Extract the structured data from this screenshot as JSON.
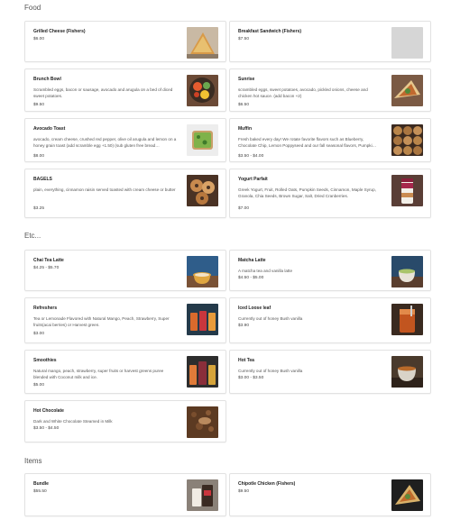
{
  "sections": {
    "food": {
      "title": "Food",
      "items": [
        {
          "name": "Grilled Cheese (Fishers)",
          "desc": "",
          "price": "$6.00",
          "image": "grilled-cheese-photo"
        },
        {
          "name": "Breakfast Sandwich (Fishers)",
          "desc": "",
          "price": "$7.50",
          "image": "placeholder-image"
        },
        {
          "name": "Brunch Bowl",
          "desc": "Scrambled eggs, bacon or sausage, avocado and arugula on a bed of diced sweet potatoes.",
          "price": "$9.50",
          "image": "brunch-bowl-photo"
        },
        {
          "name": "Sunrise",
          "desc": "scrambled eggs, sweet potatoes, avocado, pickled onions, cheese and chicken hot sauce. (add bacon +2)",
          "price": "$6.50",
          "image": "sunrise-photo"
        },
        {
          "name": "Avocado Toast",
          "desc": "avocado, cream cheese, crushed red pepper, olive oil arugula and lemon on a honey grain toast (add scramble egg +1.50) (sub gluten free bread…",
          "price": "$8.00",
          "image": "avocado-toast-photo"
        },
        {
          "name": "Muffin",
          "desc": "Fresh baked every day! We rotate favorite flavors such as Blueberry, Chocolate Chip, Lemon Poppyseed and our fall seasonal flavors, Pumpki…",
          "price": "$3.50 - $4.00",
          "image": "muffin-photo"
        },
        {
          "name": "BAGELS",
          "desc": "plain, everything, cinnamon raisin served toasted with cream cheese or butter",
          "price": "$3.25",
          "image": "bagels-photo"
        },
        {
          "name": "Yogurt Parfait",
          "desc": "Greek Yogurt, Fruit, Rolled Oats, Pumpkin Seeds, Cinnamon, Maple Syrup, Granola, Chia Seeds, Brown Sugar, Salt, Dried Cranberries.",
          "price": "$7.00",
          "image": "yogurt-parfait-photo"
        }
      ]
    },
    "etc": {
      "title": "Etc...",
      "items": [
        {
          "name": "Chai Tea Latte",
          "desc": "",
          "price": "$4.25 - $5.70",
          "image": "chai-latte-photo"
        },
        {
          "name": "Matcha Latte",
          "desc": "A matcha tea and vanilla latte",
          "price": "$4.50 - $5.00",
          "image": "matcha-latte-photo"
        },
        {
          "name": "Refreshers",
          "desc": "Tea or Lemonade Flavored with Natural Mango, Peach, Strawberry, Super fruits(acai berries) or Harvest green.",
          "price": "$3.00",
          "image": "refreshers-photo"
        },
        {
          "name": "Iced Loose leaf",
          "desc": "Currently out of honey Bush vanilla",
          "price": "$3.90",
          "image": "iced-tea-photo"
        },
        {
          "name": "Smoothies",
          "desc": "Natural mango, peach, strawberry, super fruits or harvest greens puree blended with Coconut milk and ice.",
          "price": "$5.00",
          "image": "smoothies-photo"
        },
        {
          "name": "Hot Tea",
          "desc": "Currently out of honey Bush vanilla",
          "price": "$3.00 - $3.50",
          "image": "hot-tea-photo"
        },
        {
          "name": "Hot Chocolate",
          "desc": "Dark and White Chocolate Steamed in Milk",
          "price": "$3.50 - $4.50",
          "image": "hot-chocolate-photo"
        }
      ]
    },
    "items": {
      "title": "Items",
      "items": [
        {
          "name": "Bundle",
          "desc": "",
          "price": "$55.50",
          "image": "bundle-photo"
        },
        {
          "name": "Chipotle Chicken (Fishers)",
          "desc": "",
          "price": "$9.50",
          "image": "chipotle-chicken-photo"
        }
      ]
    }
  }
}
